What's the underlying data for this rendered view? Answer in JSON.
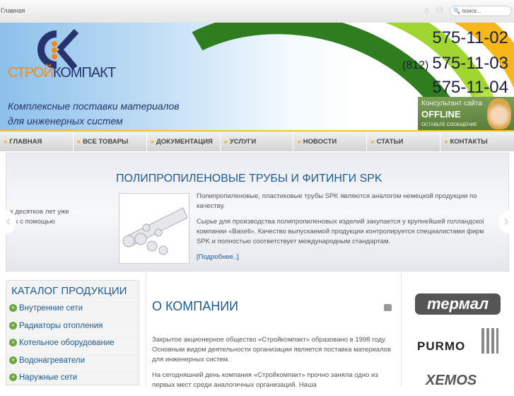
{
  "topbar": {
    "breadcrumb": "Главная",
    "search_placeholder": "поиск..."
  },
  "banner": {
    "brand_orange": "СТРОЙ",
    "brand_blue": "КОМПАКТ",
    "tagline_1": "Комплексные поставки материалов",
    "tagline_2": "для инженерных систем",
    "phone_code": "(812)",
    "phones": [
      "575-11-02",
      "575-11-03",
      "575-11-04"
    ],
    "consultant": {
      "title": "Консультант сайта",
      "status": "OFFLINE",
      "action": "ОСТАВЬТЕ СООБЩЕНИЕ"
    }
  },
  "nav": [
    "ГЛАВНАЯ",
    "ВСЕ ТОВАРЫ",
    "ДОКУМЕНТАЦИЯ",
    "УСЛУГИ",
    "НОВОСТИ",
    "СТАТЬИ",
    "КОНТАКТЫ"
  ],
  "slider": {
    "title": "ПОЛИПРОПИЛЕНОВЫЕ ТРУБЫ И ФИТИНГИ SPK",
    "p1": "Полипропиленовые, пластиковые трубы SPK являются аналогом немецкой продукции по качеству.",
    "p2": "Сырье для производства полипропиленовых изделий закупается у крупнейшей голландской компании «Basell». Качество выпускаемой продукции контролируется специалистами фирмы SPK и полностью соответствует международным стандартам.",
    "more": "[Подробнее..]",
    "prev_1": "х десятков лет уже",
    "prev_2": "ых с помощью"
  },
  "catalog": {
    "title": "КАТАЛОГ ПРОДУКЦИИ",
    "items": [
      "Внутренние сети",
      "Радиаторы отопления",
      "Котельное оборудование",
      "Водонагреватели",
      "Наружные сети"
    ]
  },
  "about": {
    "title": "О КОМПАНИИ",
    "p1": "Закрытое акционерное общество «Стройкомпакт» образовано в 1998 году. Основным видом деятельности организации является поставка материалов для инженерных систем.",
    "p2": "На сегодняшний день компания «Стройкомпакт» прочно заняла одно из первых мест среди аналогичных организаций. Наша"
  },
  "brands": [
    "термал",
    "PURMO",
    "XEMOS"
  ]
}
